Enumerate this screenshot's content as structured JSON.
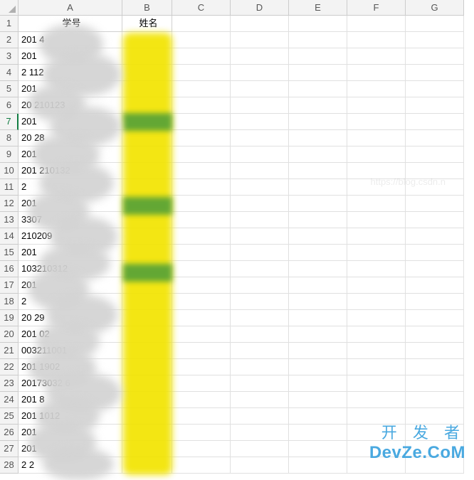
{
  "columns": [
    "A",
    "B",
    "C",
    "D",
    "E",
    "F",
    "G"
  ],
  "headerRow": {
    "a": "学号",
    "b": "姓名"
  },
  "selectedRow": 7,
  "rows": [
    {
      "n": 1,
      "a": "学号",
      "b": "姓名",
      "isHeader": true
    },
    {
      "n": 2,
      "a": "201                4",
      "b": ""
    },
    {
      "n": 3,
      "a": "201",
      "b": ""
    },
    {
      "n": 4,
      "a": "2              112",
      "b": ""
    },
    {
      "n": 5,
      "a": "201",
      "b": ""
    },
    {
      "n": 6,
      "a": "20        210123",
      "b": ""
    },
    {
      "n": 7,
      "a": "201",
      "b": ""
    },
    {
      "n": 8,
      "a": "20              28",
      "b": ""
    },
    {
      "n": 9,
      "a": "201",
      "b": ""
    },
    {
      "n": 10,
      "a": "201       210132",
      "b": ""
    },
    {
      "n": 11,
      "a": "2",
      "b": ""
    },
    {
      "n": 12,
      "a": "201",
      "b": ""
    },
    {
      "n": 13,
      "a": "            3307",
      "b": ""
    },
    {
      "n": 14,
      "a": "         210209",
      "b": ""
    },
    {
      "n": 15,
      "a": "201",
      "b": ""
    },
    {
      "n": 16,
      "a": "    103210312",
      "b": ""
    },
    {
      "n": 17,
      "a": "201",
      "b": ""
    },
    {
      "n": 18,
      "a": "2",
      "b": ""
    },
    {
      "n": 19,
      "a": "20              29",
      "b": ""
    },
    {
      "n": 20,
      "a": "201             02",
      "b": ""
    },
    {
      "n": 21,
      "a": "      003211001",
      "b": ""
    },
    {
      "n": 22,
      "a": "201       1902",
      "b": ""
    },
    {
      "n": 23,
      "a": "20173032      6",
      "b": ""
    },
    {
      "n": 24,
      "a": "201            8",
      "b": ""
    },
    {
      "n": 25,
      "a": "201       1012",
      "b": ""
    },
    {
      "n": 26,
      "a": "201",
      "b": ""
    },
    {
      "n": 27,
      "a": "201",
      "b": ""
    },
    {
      "n": 28,
      "a": "2                2",
      "b": ""
    }
  ],
  "watermark": {
    "cn": "开 发 者",
    "en": "DevZe.CoM",
    "faint": "https://blog.csdn.n"
  }
}
